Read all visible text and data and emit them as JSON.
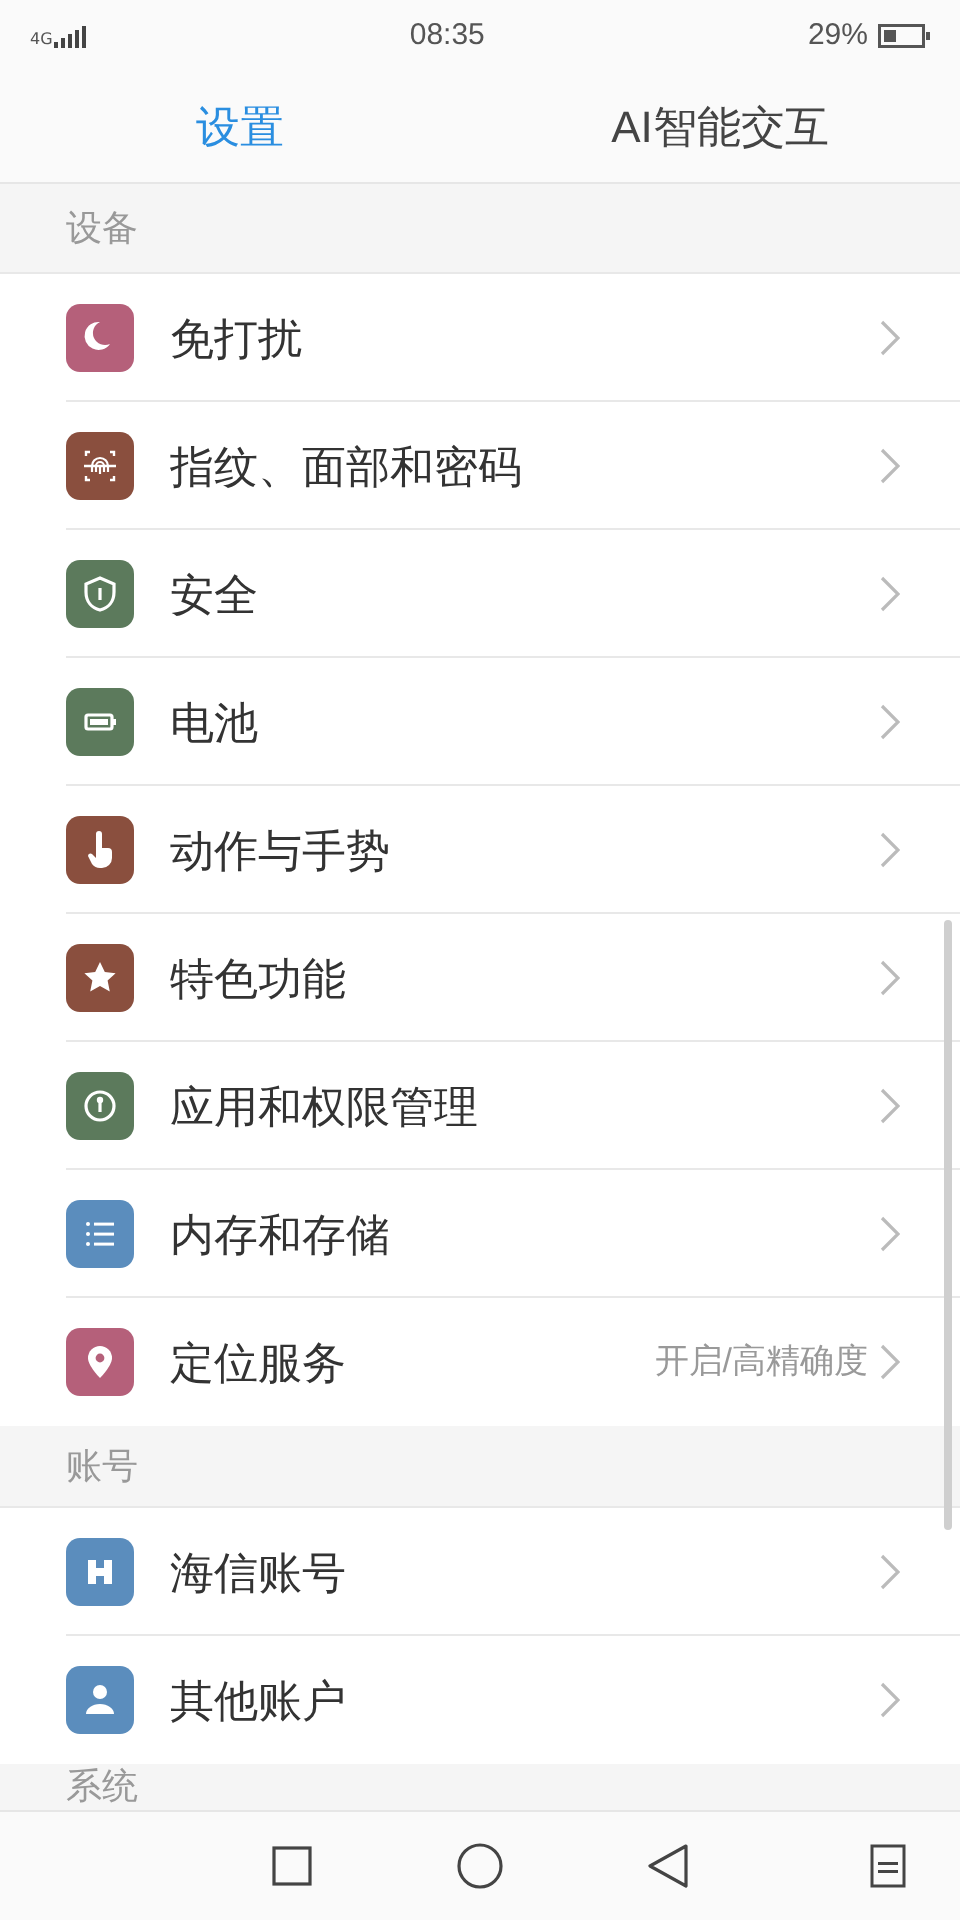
{
  "status_bar": {
    "network": "4G",
    "time": "08:35",
    "battery": "29%"
  },
  "tabs": [
    {
      "label": "设置",
      "selected": true
    },
    {
      "label": "AI智能交互",
      "selected": false
    }
  ],
  "sections": [
    {
      "title": "设备",
      "items": [
        {
          "label": "免打扰",
          "color": "#b5607a"
        },
        {
          "label": "指纹、面部和密码",
          "color": "#8a4f3e"
        },
        {
          "label": "安全",
          "color": "#5c7a5c"
        },
        {
          "label": "电池",
          "color": "#5c7a5c"
        },
        {
          "label": "动作与手势",
          "color": "#8a4f3e"
        },
        {
          "label": "特色功能",
          "color": "#8a4f3e"
        },
        {
          "label": "应用和权限管理",
          "color": "#5c7a5c"
        },
        {
          "label": "内存和存储",
          "color": "#5b8dbd"
        },
        {
          "label": "定位服务",
          "color": "#b5607a",
          "value": "开启/高精确度"
        }
      ]
    },
    {
      "title": "账号",
      "items": [
        {
          "label": "海信账号",
          "color": "#5b8dbd"
        },
        {
          "label": "其他账户",
          "color": "#5b8dbd"
        }
      ]
    },
    {
      "title": "系统"
    }
  ]
}
